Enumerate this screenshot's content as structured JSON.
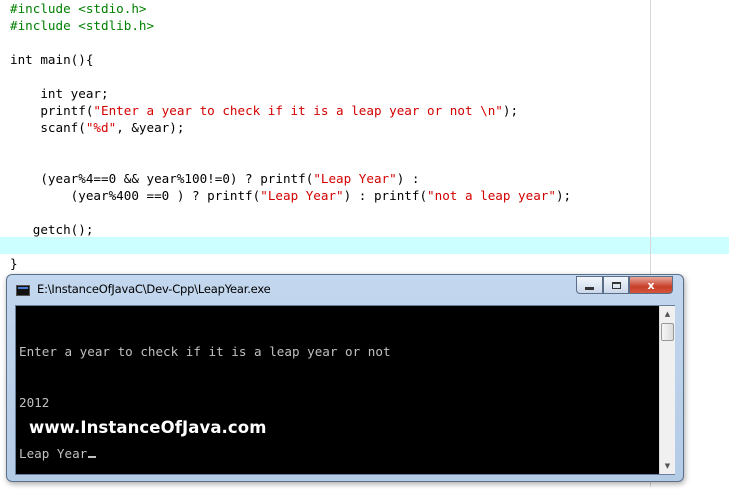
{
  "editor": {
    "lines": [
      {
        "indent": "",
        "tokens": [
          {
            "t": "pp",
            "v": "#include <stdio.h>"
          }
        ]
      },
      {
        "indent": "",
        "tokens": [
          {
            "t": "pp",
            "v": "#include <stdlib.h>"
          }
        ]
      },
      {
        "indent": "",
        "tokens": []
      },
      {
        "indent": "",
        "tokens": [
          {
            "t": "plain",
            "v": "int main(){"
          }
        ]
      },
      {
        "indent": "",
        "tokens": []
      },
      {
        "indent": "    ",
        "tokens": [
          {
            "t": "plain",
            "v": "int year;"
          }
        ]
      },
      {
        "indent": "    ",
        "tokens": [
          {
            "t": "plain",
            "v": "printf("
          },
          {
            "t": "str",
            "v": "\"Enter a year to check if it is a leap year or not \\n\""
          },
          {
            "t": "plain",
            "v": ");"
          }
        ]
      },
      {
        "indent": "    ",
        "tokens": [
          {
            "t": "plain",
            "v": "scanf("
          },
          {
            "t": "str",
            "v": "\"%d\""
          },
          {
            "t": "plain",
            "v": ", &year);"
          }
        ]
      },
      {
        "indent": "",
        "tokens": []
      },
      {
        "indent": "",
        "tokens": []
      },
      {
        "indent": "    ",
        "tokens": [
          {
            "t": "plain",
            "v": "(year%4==0 && year%100!=0) ? printf("
          },
          {
            "t": "str",
            "v": "\"Leap Year\""
          },
          {
            "t": "plain",
            "v": ") :"
          }
        ]
      },
      {
        "indent": "        ",
        "tokens": [
          {
            "t": "plain",
            "v": "(year%400 ==0 ) ? printf("
          },
          {
            "t": "str",
            "v": "\"Leap Year\""
          },
          {
            "t": "plain",
            "v": ") : printf("
          },
          {
            "t": "str",
            "v": "\"not a leap year\""
          },
          {
            "t": "plain",
            "v": ");"
          }
        ]
      },
      {
        "indent": "",
        "tokens": []
      },
      {
        "indent": "   ",
        "tokens": [
          {
            "t": "plain",
            "v": "getch();"
          }
        ]
      },
      {
        "indent": "",
        "tokens": []
      },
      {
        "indent": "",
        "tokens": [
          {
            "t": "plain",
            "v": "}"
          }
        ]
      }
    ]
  },
  "console": {
    "title": "E:\\InstanceOfJavaC\\Dev-Cpp\\LeapYear.exe",
    "minimize_icon": "minimize-icon",
    "maximize_icon": "maximize-icon",
    "close_label": "x",
    "output": [
      "Enter a year to check if it is a leap year or not",
      "2012",
      "Leap Year"
    ],
    "watermark": "www.InstanceOfJava.com",
    "scroll_up": "▲",
    "scroll_down": "▼"
  },
  "colors": {
    "preprocessor": "#008000",
    "string": "#d40000",
    "current_line": "#ccffff",
    "console_bg": "#000000",
    "console_fg": "#c0c0c0"
  }
}
